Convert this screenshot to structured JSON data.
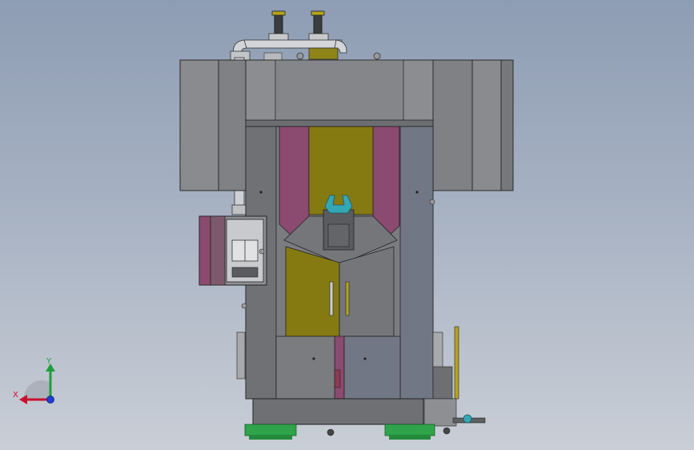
{
  "triad": {
    "x_label": "X",
    "y_label": "Y",
    "x_color": "#c8102e",
    "y_color": "#1e9e3a",
    "z_color": "#1f3fd6"
  },
  "model": {
    "palette": {
      "casing": "#7e7f82",
      "casing_dark": "#6b6c70",
      "panel_blue": "#727786",
      "magenta": "#8b4a6f",
      "olive": "#857a12",
      "cabinet": "#8d8f92",
      "steel": "#c8c9cc",
      "feet": "#2fa44a",
      "cyan": "#34a7b5"
    }
  }
}
